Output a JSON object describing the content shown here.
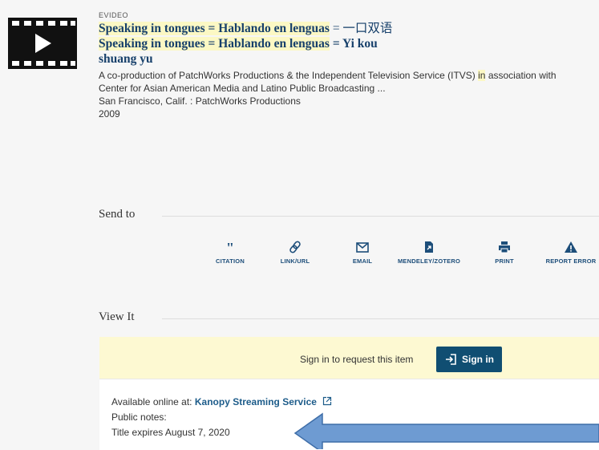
{
  "record": {
    "type": "EVIDEO",
    "title_line1_hl": "Speaking in tongues = Hablando en lenguas",
    "title_line1_rest": " = 一口双语",
    "title_line2_hl": "Speaking in tongues = Hablando en lenguas",
    "title_line2_rest": " = Yi kou",
    "title_line3": "shuang yu",
    "desc_line1_pre": "A co-production of PatchWorks Productions & the Independent Television Service (ITVS) ",
    "desc_line1_hl": "in",
    "desc_line1_post": " association with",
    "desc_line2": "Center for Asian American Media and Latino Public Broadcasting ...",
    "publisher": "San Francisco, Calif. : PatchWorks Productions",
    "year": "2009"
  },
  "send_to": {
    "heading": "Send to",
    "actions": [
      {
        "label": "CITATION",
        "icon": "quote-icon"
      },
      {
        "label": "LINK/URL",
        "icon": "link-icon"
      },
      {
        "label": "EMAIL",
        "icon": "envelope-icon"
      },
      {
        "label": "MENDELEY/ZOTERO",
        "icon": "document-export-icon"
      },
      {
        "label": "PRINT",
        "icon": "printer-icon"
      },
      {
        "label": "REPORT ERROR",
        "icon": "warning-icon"
      }
    ]
  },
  "view_it": {
    "heading": "View It",
    "sign_in_prompt": "Sign in to request this item",
    "sign_in_button": "Sign in",
    "available_label": "Available online at: ",
    "service_link": "Kanopy Streaming Service",
    "public_notes": "Public notes:",
    "expires": "Title expires August 7, 2020"
  },
  "colors": {
    "title": "#17406b",
    "highlight": "#fcf8c4",
    "button": "#104e72",
    "arrow": "#6e9bd2"
  }
}
